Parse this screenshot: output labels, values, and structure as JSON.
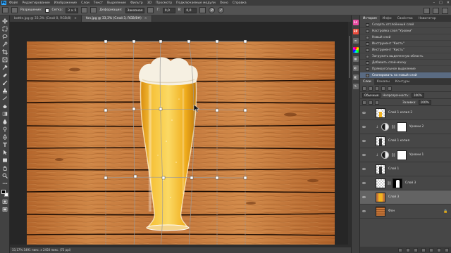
{
  "menu": [
    "Файл",
    "Редактирование",
    "Изображение",
    "Слои",
    "Текст",
    "Выделение",
    "Фильтр",
    "3D",
    "Просмотр",
    "Подключаемые модули",
    "Окно",
    "Справка"
  ],
  "window_controls": [
    "–",
    "□",
    "✕"
  ],
  "options": {
    "feather_label": "Разрешение:",
    "grid_label": "Сетка:",
    "grid_value": "3 × 5",
    "warp_label": "Деформация:",
    "warp_value": "Заказная",
    "h_label": "Г:",
    "h_value": "0,0",
    "v_label": "В:",
    "v_value": "0,0",
    "cancel": "⊘",
    "commit": "✓"
  },
  "tabs": [
    {
      "label": "bottle.jpg @ 33,3% (Слой 0, RGB/8)",
      "active": false
    },
    {
      "label": "fon.jpg @ 33,3% (Слой 3, RGB/8#)",
      "active": true
    }
  ],
  "status": "33,17%   5491 пикс. x 2450 пикс. (72 ppi)",
  "panels": {
    "history_tabs": [
      "История",
      "Инфо",
      "Свойства",
      "Навигатор"
    ],
    "history_items": [
      "Создать отслоённый слой",
      "Настройка слоя \"Уровни\"",
      "Новый слой",
      "Инструмент \"Кисть\"",
      "Инструмент \"Кисть\"",
      "Загрузить выделенную область",
      "Добавить слой-маску",
      "Прямоугольное выделение",
      "Скопировать на новый слой"
    ],
    "history_selected": 8,
    "layers_tabs": [
      "Слои",
      "Каналы",
      "Контуры"
    ],
    "blend_mode": "Обычные",
    "opacity_label": "Непрозрачность:",
    "opacity_value": "100%",
    "fill_label": "Заливка:",
    "fill_value": "100%",
    "layers": [
      {
        "name": "Слой 1 копия 2",
        "kind": "glass-thumb"
      },
      {
        "name": "Уровни 2",
        "kind": "adjustment"
      },
      {
        "name": "Слой 1 копия",
        "kind": "dark-bottle"
      },
      {
        "name": "Уровни 1",
        "kind": "adjustment"
      },
      {
        "name": "Слой 1",
        "kind": "dark-bottle"
      },
      {
        "name": "Слой 3",
        "kind": "masked"
      },
      {
        "name": "Слой 3",
        "kind": "wood-selected"
      },
      {
        "name": "Фон",
        "kind": "wood"
      }
    ]
  },
  "colors": {
    "accent": "#31a8ff",
    "wood_light": "#c9783a",
    "wood_dark": "#7a3e16",
    "beer": "#f2b320",
    "foam": "#f5efe0"
  }
}
